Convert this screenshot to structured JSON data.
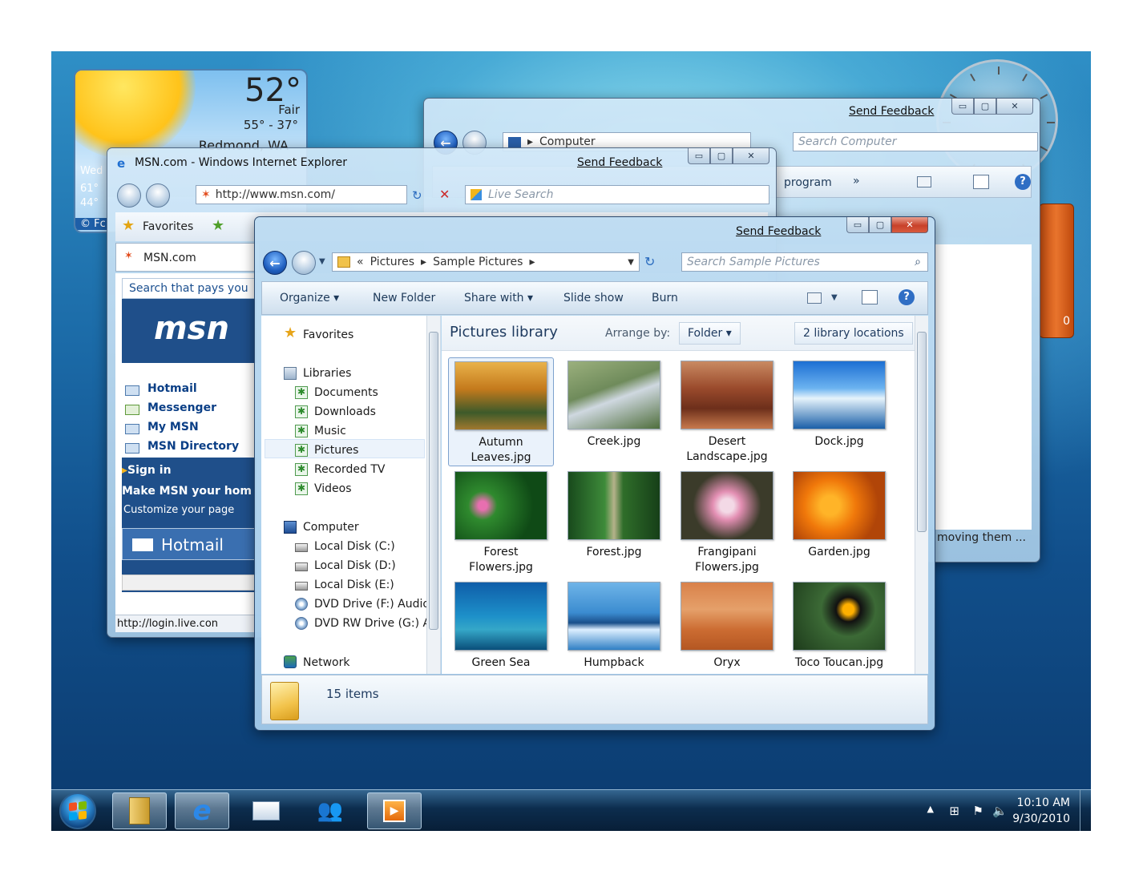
{
  "weather": {
    "temp": "52°",
    "condition": "Fair",
    "range": "55° - 37°",
    "city": "Redmond, WA",
    "side_day": "Wed",
    "side_hi": "61°",
    "side_lo": "44°",
    "side_footer": "© Fc"
  },
  "computer_window": {
    "send_feedback": "Send Feedback",
    "address": "Computer",
    "search_placeholder": "Search Computer",
    "toolbar_fragment": "program",
    "more": "»",
    "status_fragment": "moving them ..."
  },
  "ie_window": {
    "title": "MSN.com - Windows Internet Explorer",
    "send_feedback": "Send Feedback",
    "url": "http://www.msn.com/",
    "search_placeholder": "Live Search",
    "favorites_label": "Favorites",
    "tab_label": "MSN.com",
    "search_pays": "Search that pays you",
    "msn_logo": "msn",
    "links": [
      "Hotmail",
      "Messenger",
      "My MSN",
      "MSN Directory"
    ],
    "sign_in": "Sign in",
    "make_home": "Make MSN your hom",
    "customize": "Customize your page",
    "hotmail_banner": "Hotmail",
    "status_url": "http://login.live.con"
  },
  "pictures_window": {
    "send_feedback": "Send Feedback",
    "breadcrumb": [
      "Pictures",
      "Sample Pictures"
    ],
    "search_placeholder": "Search Sample Pictures",
    "toolbar": [
      "Organize",
      "New Folder",
      "Share with",
      "Slide show",
      "Burn"
    ],
    "nav": {
      "favorites": "Favorites",
      "libraries": "Libraries",
      "library_items": [
        "Documents",
        "Downloads",
        "Music",
        "Pictures",
        "Recorded TV",
        "Videos"
      ],
      "computer": "Computer",
      "drives": [
        "Local Disk (C:)",
        "Local Disk (D:)",
        "Local Disk (E:)",
        "DVD Drive (F:) Audio",
        "DVD RW Drive (G:) A"
      ],
      "network": "Network"
    },
    "library_title": "Pictures library",
    "arrange_by": "Arrange by:",
    "arrange_value": "Folder",
    "locations": "2 library locations",
    "thumbnails": [
      {
        "caption": "Autumn\nLeaves.jpg"
      },
      {
        "caption": "Creek.jpg"
      },
      {
        "caption": "Desert\nLandscape.jpg"
      },
      {
        "caption": "Dock.jpg"
      },
      {
        "caption": "Forest\nFlowers.jpg"
      },
      {
        "caption": "Forest.jpg"
      },
      {
        "caption": "Frangipani\nFlowers.jpg"
      },
      {
        "caption": "Garden.jpg"
      },
      {
        "caption": "Green Sea"
      },
      {
        "caption": "Humpback"
      },
      {
        "caption": "Oryx"
      },
      {
        "caption": "Toco Toucan.jpg"
      }
    ],
    "item_count": "15 items"
  },
  "taskbar": {
    "time": "10:10 AM",
    "date": "9/30/2010"
  },
  "orange_gadget_text": "0"
}
